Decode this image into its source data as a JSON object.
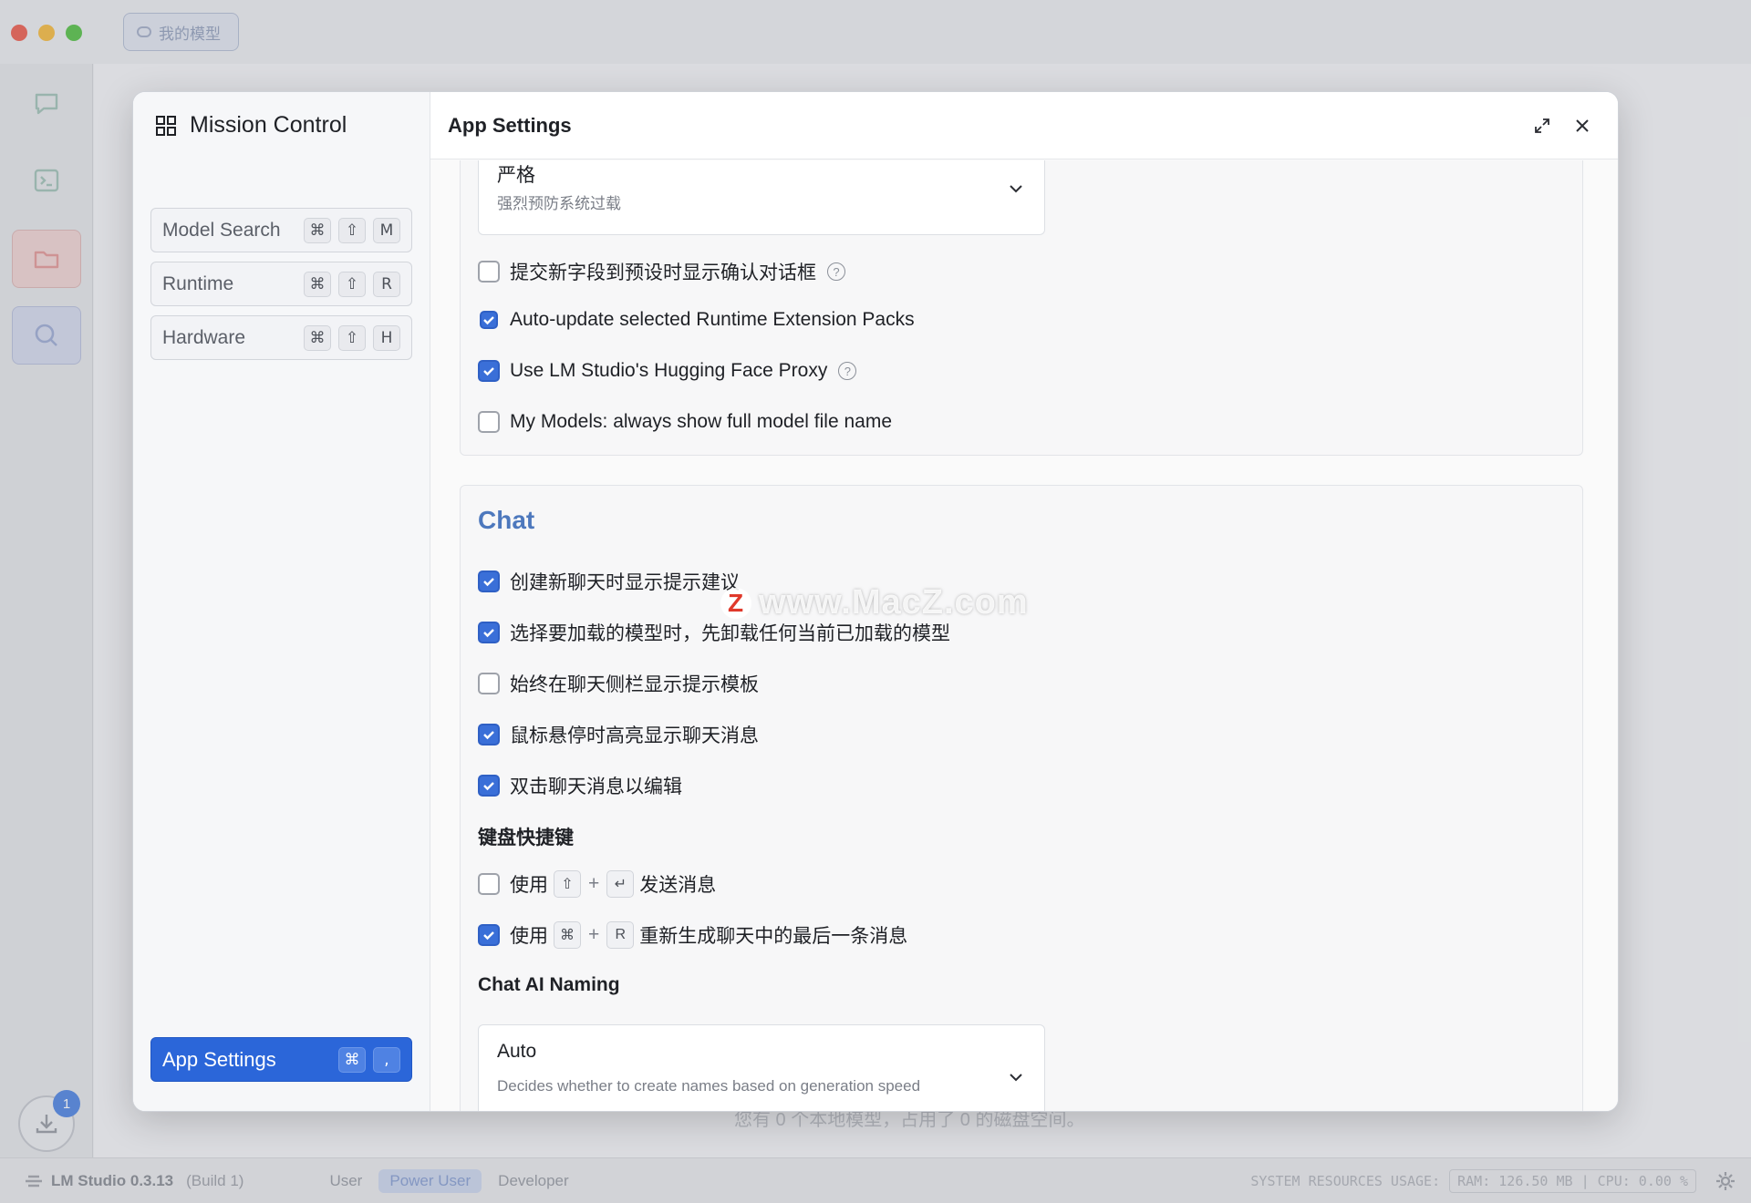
{
  "background": {
    "tab_label": "我的模型",
    "bottom_text": "您有 0 个本地模型，占用了 0 的磁盘空间。",
    "download_badge": "1",
    "status": {
      "app_name": "LM Studio 0.3.13",
      "build": "(Build 1)",
      "modes": [
        "User",
        "Power User",
        "Developer"
      ],
      "active_mode": "Power User",
      "resources_label": "SYSTEM RESOURCES USAGE:",
      "ram": "RAM: 126.50 MB",
      "cpu": "CPU: 0.00 %"
    }
  },
  "mission_control": {
    "title": "Mission Control",
    "nav": [
      {
        "label": "Model Search",
        "keys": [
          "⌘",
          "⇧",
          "M"
        ]
      },
      {
        "label": "Runtime",
        "keys": [
          "⌘",
          "⇧",
          "R"
        ]
      },
      {
        "label": "Hardware",
        "keys": [
          "⌘",
          "⇧",
          "H"
        ]
      }
    ],
    "active_nav": {
      "label": "App Settings",
      "keys": [
        "⌘",
        ","
      ]
    }
  },
  "settings": {
    "header_title": "App Settings",
    "guardrail_select": {
      "value": "严格",
      "description": "强烈预防系统过载"
    },
    "general_options": [
      {
        "label": "提交新字段到预设时显示确认对话框",
        "checked": false,
        "help": true
      },
      {
        "label": "Auto-update selected Runtime Extension Packs",
        "checked": true,
        "help": false
      },
      {
        "label": "Use LM Studio's Hugging Face Proxy",
        "checked": true,
        "help": true
      },
      {
        "label": "My Models: always show full model file name",
        "checked": false,
        "help": false
      }
    ],
    "chat": {
      "title": "Chat",
      "options": [
        {
          "label": "创建新聊天时显示提示建议",
          "checked": true
        },
        {
          "label": "选择要加载的模型时，先卸载任何当前已加载的模型",
          "checked": true
        },
        {
          "label": "始终在聊天侧栏显示提示模板",
          "checked": false
        },
        {
          "label": "鼠标悬停时高亮显示聊天消息",
          "checked": true
        },
        {
          "label": "双击聊天消息以编辑",
          "checked": true
        }
      ],
      "shortcuts_title": "键盘快捷键",
      "shortcuts": [
        {
          "prefix": "使用",
          "key1": "⇧",
          "plus": "+",
          "key2": "↵",
          "suffix": "发送消息",
          "checked": false
        },
        {
          "prefix": "使用",
          "key1": "⌘",
          "plus": "+",
          "key2": "R",
          "suffix": "重新生成聊天中的最后一条消息",
          "checked": true
        }
      ],
      "naming_title": "Chat AI Naming",
      "naming_select": {
        "value": "Auto",
        "description": "Decides whether to create names based on generation speed"
      }
    }
  },
  "watermark": {
    "logo": "Z",
    "text": "www.MacZ.com"
  },
  "colors": {
    "accent": "#2b66d9",
    "chat_title": "#4d78bd",
    "checkbox_on": "#3a6fd8"
  }
}
